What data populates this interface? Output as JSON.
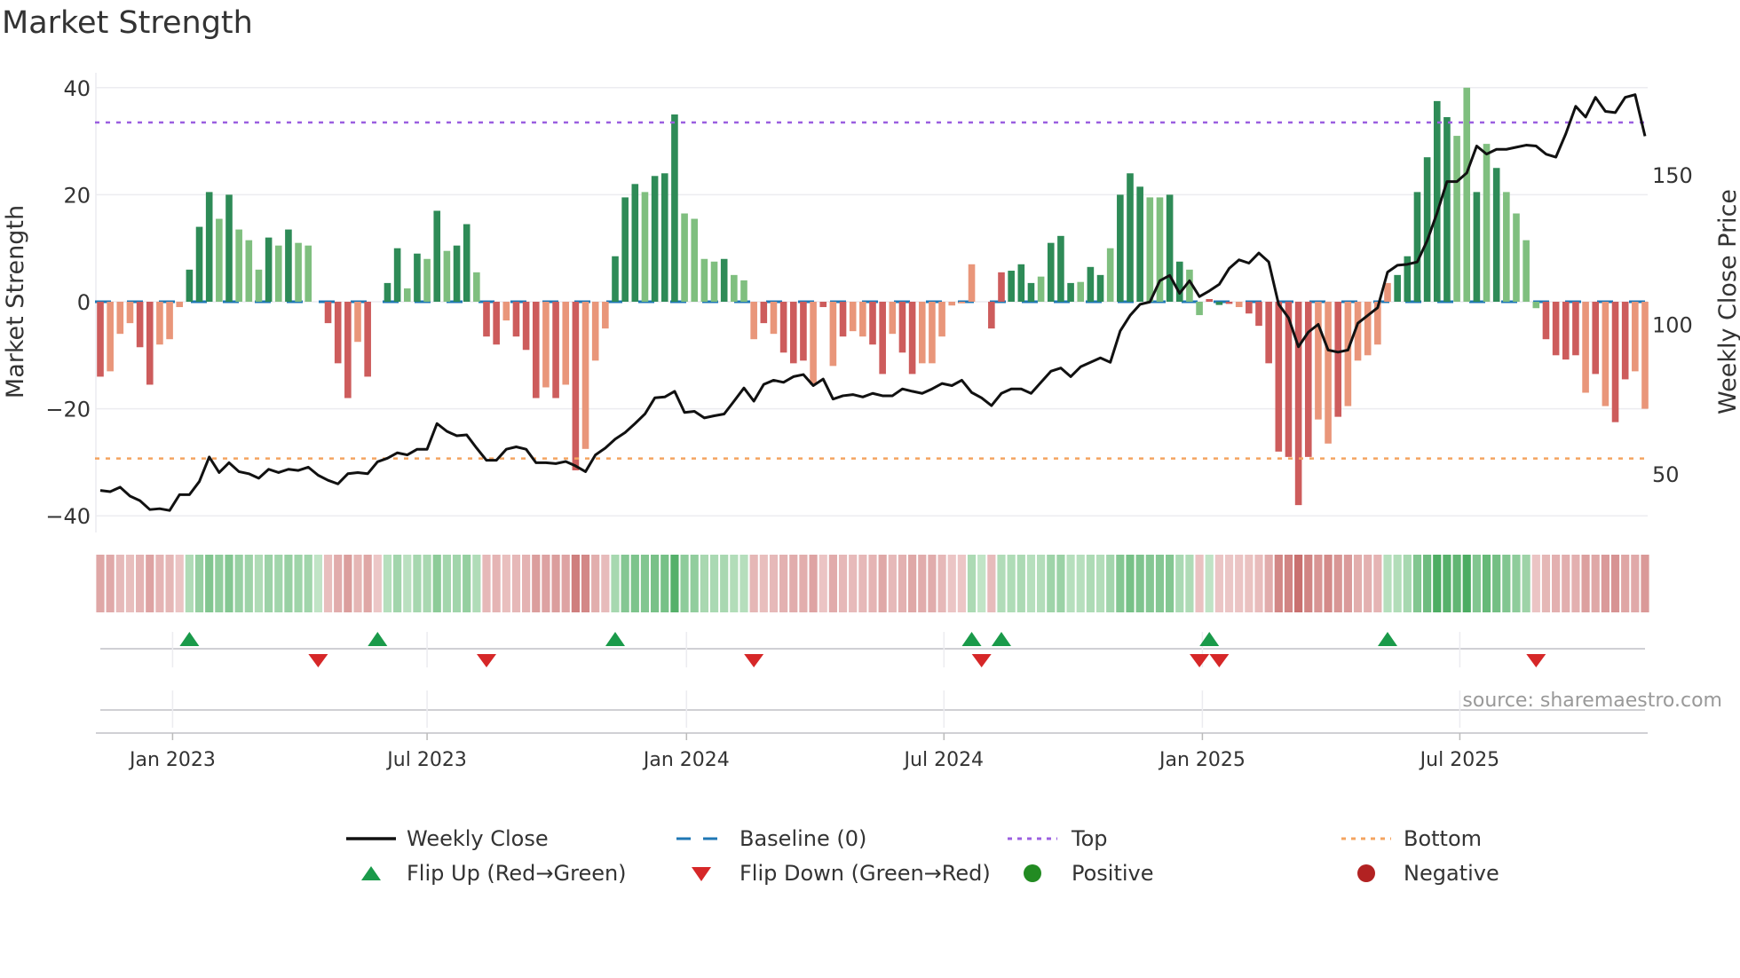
{
  "title": "Market Strength",
  "source": "source: sharemaestro.com",
  "legend": [
    {
      "label": "Weekly Close",
      "symbol": "line",
      "color": "#111111"
    },
    {
      "label": "Baseline (0)",
      "symbol": "dash",
      "color": "#1f77b4"
    },
    {
      "label": "Top",
      "symbol": "dot",
      "color": "#9b5fe0"
    },
    {
      "label": "Bottom",
      "symbol": "dot",
      "color": "#f4a460"
    },
    {
      "label": "Flip Up (Red→Green)",
      "symbol": "tri-up",
      "color": "#1a9a4a"
    },
    {
      "label": "Flip Down (Green→Red)",
      "symbol": "tri-down",
      "color": "#d62728"
    },
    {
      "label": "Positive",
      "symbol": "circle",
      "color": "#228b22"
    },
    {
      "label": "Negative",
      "symbol": "circle",
      "color": "#b22222"
    }
  ],
  "chart_data": {
    "type": "bar",
    "title": "Market Strength",
    "ylabel": "Market Strength",
    "y2label": "Weekly Close Price",
    "ylim": [
      -43,
      43
    ],
    "yticks": [
      40,
      20,
      0,
      -20,
      -40
    ],
    "ytick_labels": [
      "40",
      "20",
      "0",
      "−20",
      "−40"
    ],
    "y2lim": [
      30,
      190
    ],
    "y2ticks": [
      150,
      100,
      50
    ],
    "y2tick_labels": [
      "150",
      "100",
      "50"
    ],
    "xticks": [
      {
        "week": 7.3,
        "label": "Jan 2023"
      },
      {
        "week": 33.0,
        "label": "Jul 2023"
      },
      {
        "week": 59.2,
        "label": "Jan 2024"
      },
      {
        "week": 85.2,
        "label": "Jul 2024"
      },
      {
        "week": 111.3,
        "label": "Jan 2025"
      },
      {
        "week": 137.3,
        "label": "Jul 2025"
      }
    ],
    "top_level": 33.5,
    "bottom_level": -29.3,
    "bar_colors": {
      "G": "#2e8b57",
      "g": "#7fbf7f",
      "R": "#cd5c5c",
      "r": "#e9967a"
    },
    "strength": [
      -14,
      -13,
      -6,
      -4,
      -8.5,
      -15.5,
      -8,
      -7,
      -1,
      6,
      14,
      20.5,
      15.5,
      20,
      13.5,
      11.5,
      6,
      12,
      10.5,
      13.5,
      11,
      10.5,
      0,
      -4,
      -11.5,
      -18,
      -7.5,
      -14,
      0,
      3.5,
      10,
      2.5,
      9,
      8,
      17,
      9.5,
      10.5,
      14.5,
      5.5,
      -6.5,
      -8,
      -3.5,
      -6.5,
      -9,
      -18,
      -16,
      -18,
      -15.5,
      -31.5,
      -27.5,
      -11,
      -5,
      8.5,
      19.5,
      22,
      20.5,
      23.5,
      24,
      35,
      16.5,
      15.5,
      8,
      7.5,
      8,
      5,
      4,
      -7,
      -4,
      -6,
      -9.5,
      -11.5,
      -11,
      -15.5,
      -1,
      -12,
      -6.5,
      -5.5,
      -6.5,
      -8,
      -13.5,
      -6,
      -9.5,
      -13.5,
      -11.5,
      -11.5,
      -6.5,
      -0.7,
      -0.3,
      7,
      0,
      -5,
      5.5,
      5.8,
      7,
      3.5,
      4.7,
      11,
      12.3,
      3.5,
      3.7,
      6.5,
      5,
      10,
      20,
      24,
      21.5,
      19.5,
      19.5,
      20,
      7.5,
      6,
      -2.5,
      0.5,
      -0.6,
      -0.4,
      -1,
      -2.2,
      -4.5,
      -11.5,
      -28,
      -29,
      -38,
      -29,
      -22,
      -26.5,
      -21.5,
      -19.5,
      -11,
      -10,
      -8,
      3.5,
      5,
      8.5,
      20.5,
      27,
      37.5,
      34.5,
      31,
      40,
      20.5,
      29.5,
      25,
      20.5,
      16.5,
      11.5,
      -1.2,
      -7,
      -10,
      -10.8,
      -10,
      -17,
      -13.5,
      -19.5,
      -22.5,
      -14.5,
      -13,
      -20
    ],
    "bar_type": "RrrrRRrrrGGGgGggg GgGgg0RRRrR0GGgGgGgGGgRRrRRRrRrRrrrGGGgGGGggggGggrRrRRRrRrRrrRRrRRrrrrrrG0RGGGgGGGgGGgGGGggGGggRGRrRRRRRRRrrRrrrrrGGGGGGggGgGgggg RRRRrRrRRrrR",
    "close": [
      44.4,
      44,
      45.5,
      42.5,
      41,
      38,
      38.3,
      37.7,
      43,
      43,
      47.4,
      55.6,
      50.4,
      53.7,
      50.7,
      50,
      48.5,
      51.5,
      50.4,
      51.5,
      51.1,
      52.2,
      49.5,
      47.8,
      46.6,
      50,
      50.4,
      50,
      54,
      55.2,
      57,
      56.3,
      58.2,
      58.2,
      66.8,
      64.2,
      62.7,
      63,
      58.6,
      54.5,
      54.5,
      58.2,
      59,
      58.2,
      53.7,
      53.7,
      53.4,
      54.1,
      52.6,
      50.7,
      56.3,
      58.6,
      61.6,
      63.8,
      66.8,
      70,
      75.4,
      75.7,
      77.6,
      70.5,
      70.9,
      68.7,
      69.4,
      70,
      74.3,
      78.7,
      74.3,
      79.9,
      81.3,
      80.6,
      82.5,
      83.2,
      79.5,
      81.7,
      75,
      76.1,
      76.5,
      75.7,
      76.9,
      76.1,
      76.1,
      78.4,
      77.6,
      76.9,
      78.4,
      80.2,
      79.5,
      81.3,
      77.2,
      75.4,
      72.8,
      76.9,
      78.4,
      78.4,
      76.9,
      80.6,
      84.3,
      85.4,
      82.5,
      85.8,
      87.3,
      88.8,
      87.3,
      97.8,
      103,
      106.7,
      107.5,
      114.6,
      116.4,
      110.4,
      114.6,
      109.3,
      111.2,
      113.4,
      118.7,
      121.6,
      120.5,
      123.9,
      120.9,
      106.7,
      102.2,
      92.5,
      97.4,
      100,
      91.4,
      90.7,
      91.4,
      100.4,
      103,
      105.6,
      117.5,
      119.8,
      120.1,
      120.9,
      128,
      137.3,
      147.8,
      147.8,
      150.7,
      159.7,
      157,
      158.6,
      158.6,
      159.3,
      160,
      159.7,
      157,
      156,
      163.8,
      173,
      169.4,
      176,
      171.3,
      170.9,
      176,
      176.9,
      163
    ],
    "flip_up_weeks": [
      9,
      28,
      52,
      88,
      91,
      112,
      130
    ],
    "flip_down_weeks": [
      22,
      39,
      66,
      89,
      111,
      113,
      145
    ]
  }
}
